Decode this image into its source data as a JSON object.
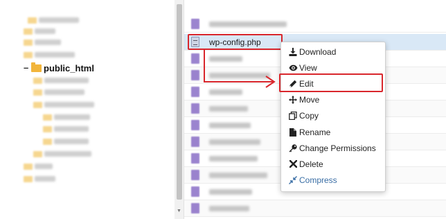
{
  "tree": {
    "active_toggle": "–",
    "active_folder": "public_html"
  },
  "files": {
    "selected_file": "wp-config.php"
  },
  "context_menu": {
    "items": [
      {
        "label": "Download",
        "icon": "download-icon"
      },
      {
        "label": "View",
        "icon": "eye-icon"
      },
      {
        "label": "Edit",
        "icon": "pencil-icon"
      },
      {
        "label": "Move",
        "icon": "move-icon"
      },
      {
        "label": "Copy",
        "icon": "copy-icon"
      },
      {
        "label": "Rename",
        "icon": "file-icon"
      },
      {
        "label": "Change Permissions",
        "icon": "key-icon"
      },
      {
        "label": "Delete",
        "icon": "x-icon"
      },
      {
        "label": "Compress",
        "icon": "compress-icon"
      }
    ]
  },
  "colors": {
    "highlight": "#d9262c",
    "compress_link": "#3a6ea5",
    "folder": "#f2b53b",
    "file_icon": "#7a5bbf"
  }
}
